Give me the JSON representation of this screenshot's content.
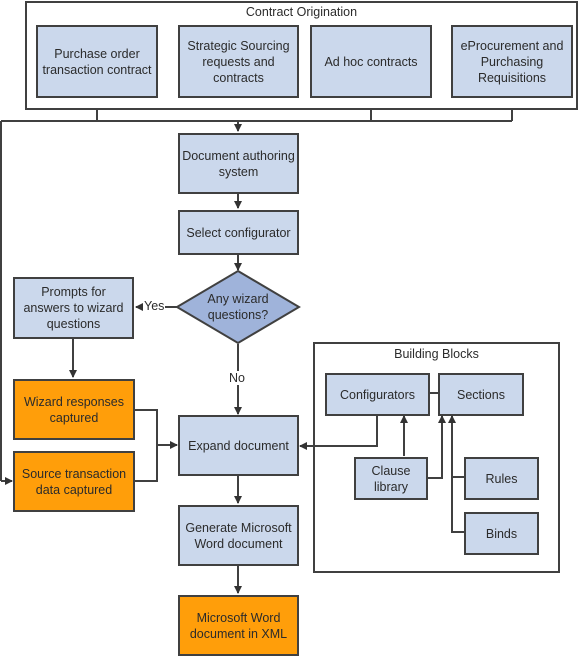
{
  "groups": {
    "origination": {
      "title": "Contract Origination"
    },
    "building_blocks": {
      "title": "Building Blocks"
    }
  },
  "nodes": {
    "purchase_order": "Purchase order transaction contract",
    "strategic_sourcing": "Strategic Sourcing requests and contracts",
    "ad_hoc": "Ad hoc contracts",
    "eprocurement": "eProcurement and Purchasing Requisitions",
    "doc_authoring": "Document authoring system",
    "select_configurator": "Select configurator",
    "wizard_decision": "Any wizard questions?",
    "prompts": "Prompts for answers to wizard questions",
    "wizard_responses": "Wizard responses captured",
    "source_transaction": "Source transaction data captured",
    "expand_document": "Expand document",
    "generate_word": "Generate Microsoft Word document",
    "word_xml": "Microsoft Word document in XML",
    "configurators": "Configurators",
    "sections": "Sections",
    "clause_library": "Clause library",
    "rules": "Rules",
    "binds": "Binds"
  },
  "edge_labels": {
    "yes": "Yes",
    "no": "No"
  },
  "colors": {
    "process_fill": "#cbd8ec",
    "decision_fill": "#9fb3da",
    "output_fill": "#ff9e0a",
    "stroke": "#404040"
  }
}
